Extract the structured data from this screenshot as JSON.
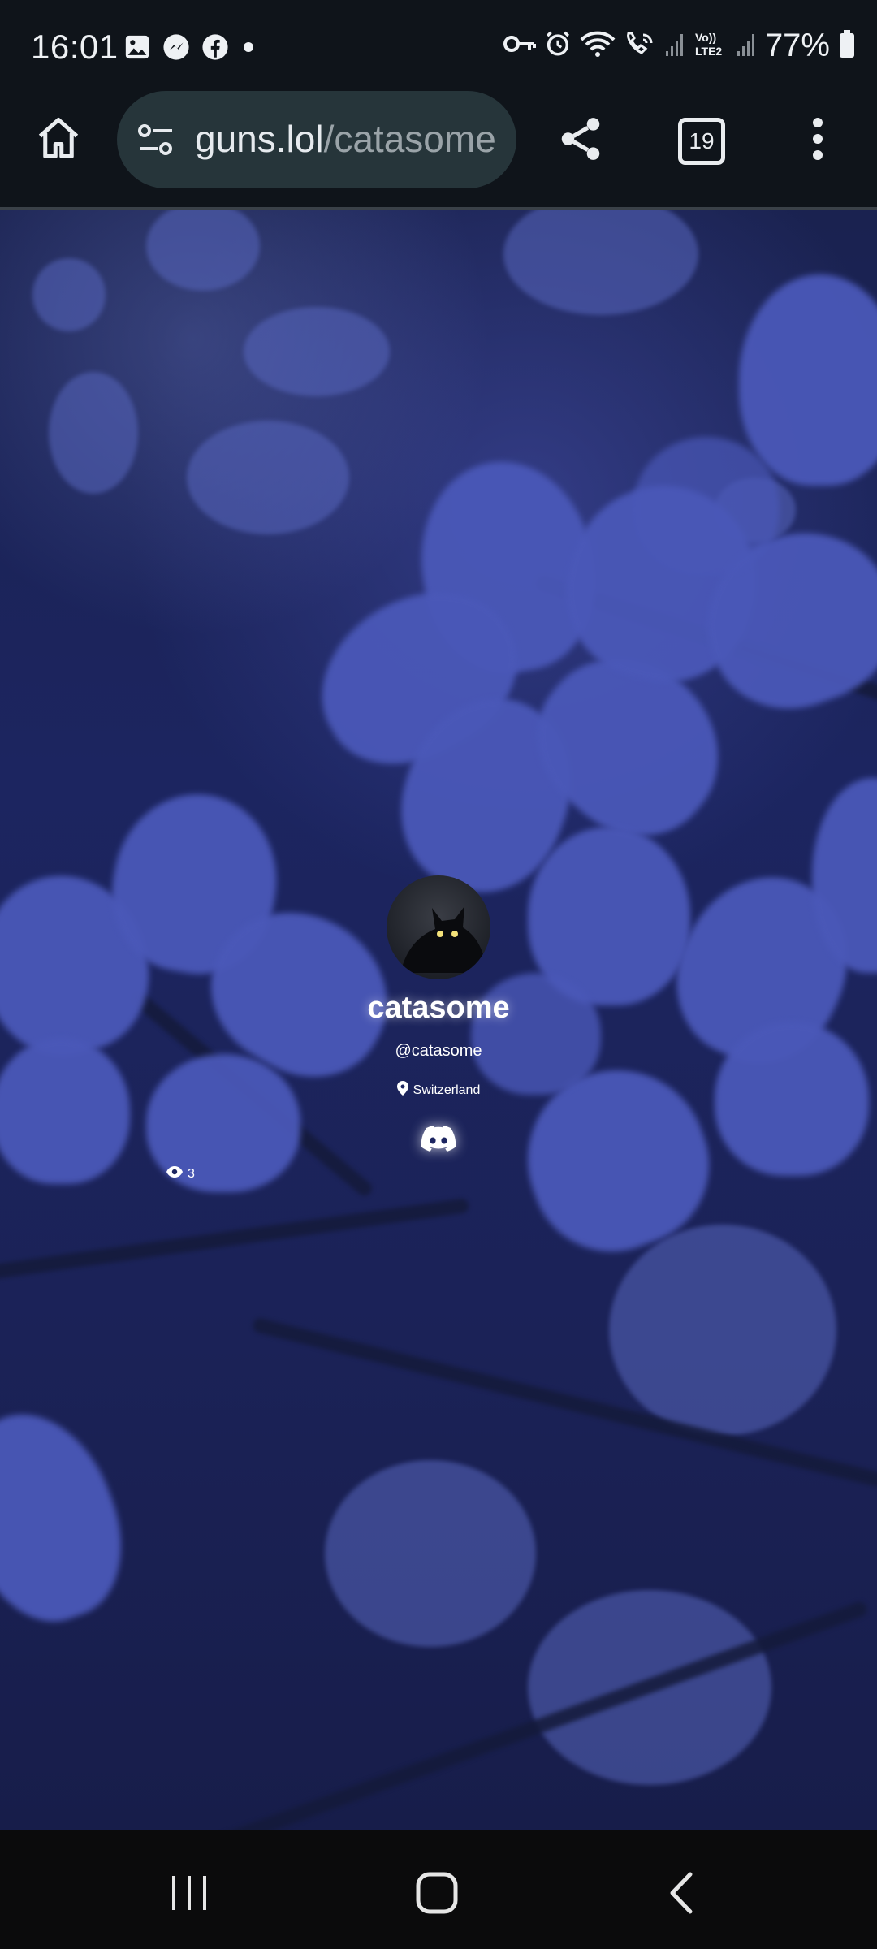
{
  "status_bar": {
    "time": "16:01",
    "battery": "77%",
    "notification_icons": [
      "gallery-icon",
      "messenger-icon",
      "facebook-icon",
      "dot-icon"
    ],
    "system_icons": [
      "vpn-key-icon",
      "alarm-icon",
      "wifi-icon",
      "wifi-calling-icon",
      "signal-icon",
      "volte-icon",
      "signal-icon",
      "battery-icon"
    ],
    "volte_label": "Vo)) LTE2"
  },
  "browser": {
    "url_domain": "guns.lol",
    "url_path": "/catasome",
    "tab_count": "19"
  },
  "profile": {
    "display_name": "catasome",
    "handle": "@catasome",
    "location": "Switzerland",
    "view_count": "3",
    "social_icons": [
      "discord-icon"
    ]
  },
  "colors": {
    "background_top": "#1c2560",
    "flower": "#4a58b8",
    "urlbar": "#26353a",
    "status_bg": "#0f141a"
  }
}
